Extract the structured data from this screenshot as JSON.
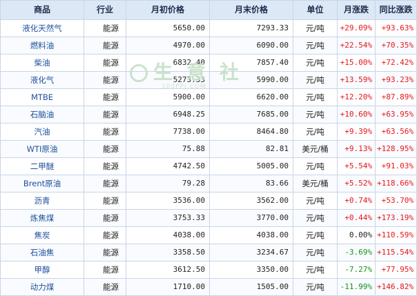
{
  "headers": [
    "商品",
    "行业",
    "月初价格",
    "月末价格",
    "单位",
    "月涨跌",
    "同比涨跌"
  ],
  "rows": [
    {
      "name": "液化天然气",
      "industry": "能源",
      "start": "5650.00",
      "end": "7293.33",
      "unit": "元/吨",
      "month": "+29.09%",
      "month_dir": "up",
      "yoy": "+93.63%",
      "yoy_dir": "up"
    },
    {
      "name": "燃料油",
      "industry": "能源",
      "start": "4970.00",
      "end": "6090.00",
      "unit": "元/吨",
      "month": "+22.54%",
      "month_dir": "up",
      "yoy": "+70.35%",
      "yoy_dir": "up"
    },
    {
      "name": "柴油",
      "industry": "能源",
      "start": "6832.40",
      "end": "7857.40",
      "unit": "元/吨",
      "month": "+15.00%",
      "month_dir": "up",
      "yoy": "+72.42%",
      "yoy_dir": "up"
    },
    {
      "name": "液化气",
      "industry": "能源",
      "start": "5273.33",
      "end": "5990.00",
      "unit": "元/吨",
      "month": "+13.59%",
      "month_dir": "up",
      "yoy": "+93.23%",
      "yoy_dir": "up"
    },
    {
      "name": "MTBE",
      "industry": "能源",
      "start": "5900.00",
      "end": "6620.00",
      "unit": "元/吨",
      "month": "+12.20%",
      "month_dir": "up",
      "yoy": "+87.89%",
      "yoy_dir": "up"
    },
    {
      "name": "石脑油",
      "industry": "能源",
      "start": "6948.25",
      "end": "7685.00",
      "unit": "元/吨",
      "month": "+10.60%",
      "month_dir": "up",
      "yoy": "+63.95%",
      "yoy_dir": "up"
    },
    {
      "name": "汽油",
      "industry": "能源",
      "start": "7738.00",
      "end": "8464.80",
      "unit": "元/吨",
      "month": "+9.39%",
      "month_dir": "up",
      "yoy": "+63.56%",
      "yoy_dir": "up"
    },
    {
      "name": "WTI原油",
      "industry": "能源",
      "start": "75.88",
      "end": "82.81",
      "unit": "美元/桶",
      "month": "+9.13%",
      "month_dir": "up",
      "yoy": "+128.95%",
      "yoy_dir": "up"
    },
    {
      "name": "二甲醚",
      "industry": "能源",
      "start": "4742.50",
      "end": "5005.00",
      "unit": "元/吨",
      "month": "+5.54%",
      "month_dir": "up",
      "yoy": "+91.03%",
      "yoy_dir": "up"
    },
    {
      "name": "Brent原油",
      "industry": "能源",
      "start": "79.28",
      "end": "83.66",
      "unit": "美元/桶",
      "month": "+5.52%",
      "month_dir": "up",
      "yoy": "+118.66%",
      "yoy_dir": "up"
    },
    {
      "name": "沥青",
      "industry": "能源",
      "start": "3536.00",
      "end": "3562.00",
      "unit": "元/吨",
      "month": "+0.74%",
      "month_dir": "up",
      "yoy": "+53.70%",
      "yoy_dir": "up"
    },
    {
      "name": "炼焦煤",
      "industry": "能源",
      "start": "3753.33",
      "end": "3770.00",
      "unit": "元/吨",
      "month": "+0.44%",
      "month_dir": "up",
      "yoy": "+173.19%",
      "yoy_dir": "up"
    },
    {
      "name": "焦炭",
      "industry": "能源",
      "start": "4038.00",
      "end": "4038.00",
      "unit": "元/吨",
      "month": "0.00%",
      "month_dir": "flat",
      "yoy": "+110.59%",
      "yoy_dir": "up"
    },
    {
      "name": "石油焦",
      "industry": "能源",
      "start": "3358.50",
      "end": "3234.67",
      "unit": "元/吨",
      "month": "-3.69%",
      "month_dir": "down",
      "yoy": "+115.54%",
      "yoy_dir": "up"
    },
    {
      "name": "甲醇",
      "industry": "能源",
      "start": "3612.50",
      "end": "3350.00",
      "unit": "元/吨",
      "month": "-7.27%",
      "month_dir": "down",
      "yoy": "+77.95%",
      "yoy_dir": "up"
    },
    {
      "name": "动力煤",
      "industry": "能源",
      "start": "1710.00",
      "end": "1505.00",
      "unit": "元/吨",
      "month": "-11.99%",
      "month_dir": "down",
      "yoy": "+146.82%",
      "yoy_dir": "up"
    }
  ],
  "watermark": {
    "text": "生意社",
    "sub": "100PPI.COM"
  },
  "colors": {
    "up": "#e8141a",
    "down": "#1a8f1a",
    "header_bg": "#dce8f6",
    "border": "#c7d5e6",
    "name_link": "#1b4f9c"
  }
}
